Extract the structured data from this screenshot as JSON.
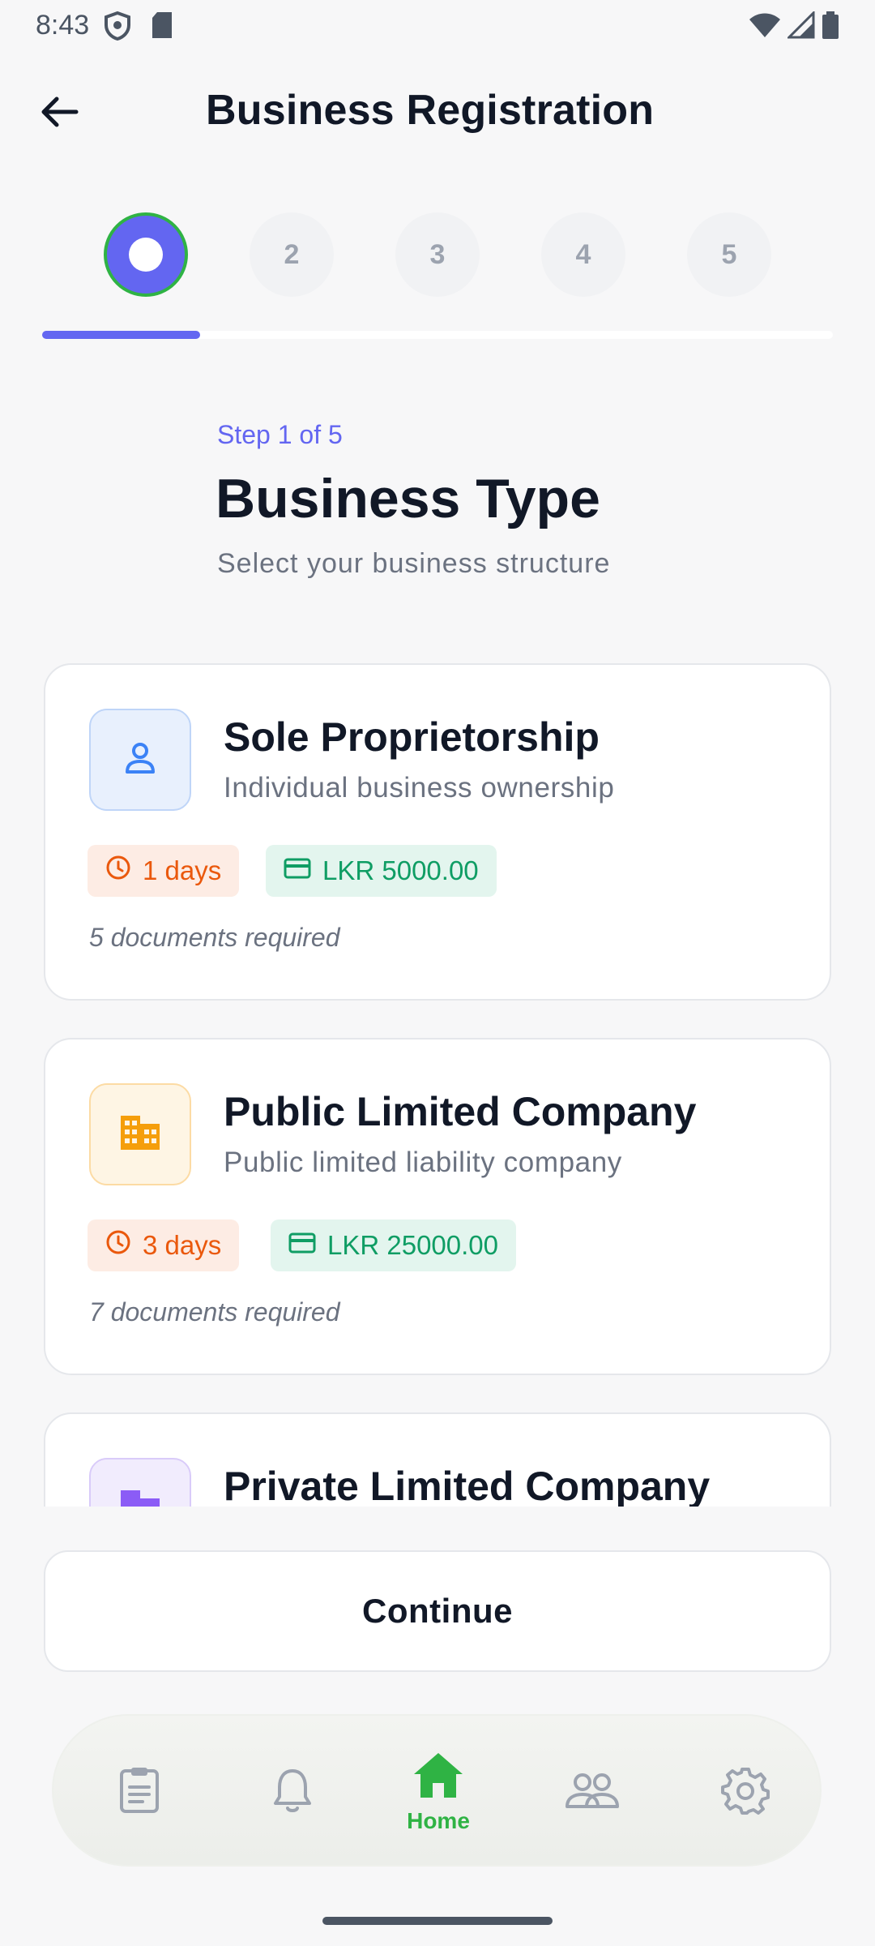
{
  "status_bar": {
    "time": "8:43"
  },
  "header": {
    "title": "Business Registration"
  },
  "stepper": {
    "steps": [
      "1",
      "2",
      "3",
      "4",
      "5"
    ],
    "current_step": 1,
    "progress_fraction": 0.2
  },
  "step_header": {
    "indicator": "Step 1 of 5",
    "title": "Business Type",
    "subtitle": "Select your business structure"
  },
  "business_types": [
    {
      "title": "Sole Proprietorship",
      "description": "Individual business ownership",
      "duration": "1 days",
      "fee": "LKR 5000.00",
      "documents": "5 documents required",
      "icon": "person-icon",
      "icon_color": "#3b82f6",
      "icon_bg": "#e8f0fd"
    },
    {
      "title": "Public Limited Company",
      "description": "Public limited liability company",
      "duration": "3 days",
      "fee": "LKR 25000.00",
      "documents": "7 documents required",
      "icon": "building-icon",
      "icon_color": "#f59e0b",
      "icon_bg": "#fef5e4"
    },
    {
      "title": "Private Limited Company",
      "icon": "building-icon",
      "icon_color": "#8b5cf6",
      "icon_bg": "#f1ecfd"
    }
  ],
  "continue_button": {
    "label": "Continue"
  },
  "bottom_nav": {
    "items": [
      {
        "icon": "clipboard-icon"
      },
      {
        "icon": "bell-icon"
      },
      {
        "icon": "home-icon",
        "label": "Home",
        "active": true
      },
      {
        "icon": "people-icon"
      },
      {
        "icon": "gear-icon"
      }
    ]
  },
  "colors": {
    "accent": "#6366f1",
    "active_green": "#2fb344",
    "time_badge": "#ea580c",
    "fee_badge": "#0f9d64"
  }
}
